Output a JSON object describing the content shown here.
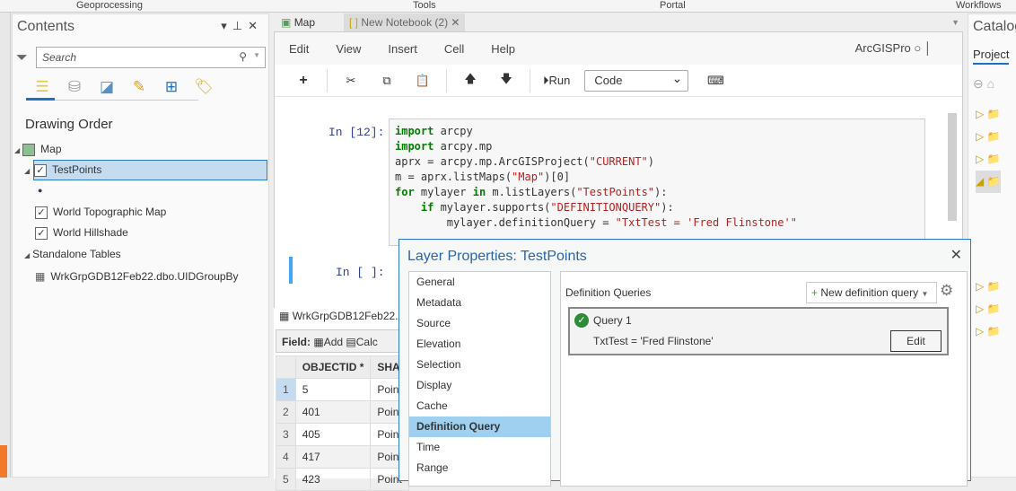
{
  "top_tabs": [
    "Geoprocessing",
    "Tools",
    "Portal",
    "Workflows"
  ],
  "contents": {
    "title": "Contents",
    "search_placeholder": "Search",
    "heading": "Drawing Order",
    "items": {
      "map": "Map",
      "testpoints": "TestPoints",
      "topo": "World Topographic Map",
      "hillshade": "World Hillshade",
      "standalone": "Standalone Tables",
      "table": "WrkGrpGDB12Feb22.dbo.UIDGroupBy"
    }
  },
  "doc_tabs": {
    "map": "Map",
    "notebook": "New Notebook (2)"
  },
  "notebook": {
    "menu": [
      "Edit",
      "View",
      "Insert",
      "Cell",
      "Help"
    ],
    "kernel": "ArcGISPro",
    "run_label": "Run",
    "cell_type": "Code",
    "prompt1": "In [12]:",
    "prompt2": "In [ ]:",
    "code": [
      "import arcpy",
      "import arcpy.mp",
      "aprx = arcpy.mp.ArcGISProject(\"CURRENT\")",
      "m = aprx.listMaps(\"Map\")[0]",
      "for mylayer in m.listLayers(\"TestPoints\"):",
      "    if mylayer.supports(\"DEFINITIONQUERY\"):",
      "        mylayer.definitionQuery = \"TxtTest = 'Fred Flinstone'\""
    ]
  },
  "attribute_table": {
    "title": "WrkGrpGDB12Feb22.",
    "field_label": "Field:",
    "add": "Add",
    "calc": "Calc",
    "columns": [
      "OBJECTID *",
      "SHA"
    ],
    "rows": [
      [
        "1",
        "5",
        "Point"
      ],
      [
        "2",
        "401",
        "Point"
      ],
      [
        "3",
        "405",
        "Point"
      ],
      [
        "4",
        "417",
        "Point"
      ],
      [
        "5",
        "423",
        "Point"
      ]
    ]
  },
  "catalog": {
    "title": "Catalog",
    "tab": "Project"
  },
  "dialog": {
    "title": "Layer Properties: TestPoints",
    "nav": [
      "General",
      "Metadata",
      "Source",
      "Elevation",
      "Selection",
      "Display",
      "Cache",
      "Definition Query",
      "Time",
      "Range"
    ],
    "active": "Definition Query",
    "section": "Definition Queries",
    "new_query": "New definition query",
    "query_name": "Query 1",
    "query_expr": "TxtTest = 'Fred Flinstone'",
    "edit": "Edit"
  }
}
